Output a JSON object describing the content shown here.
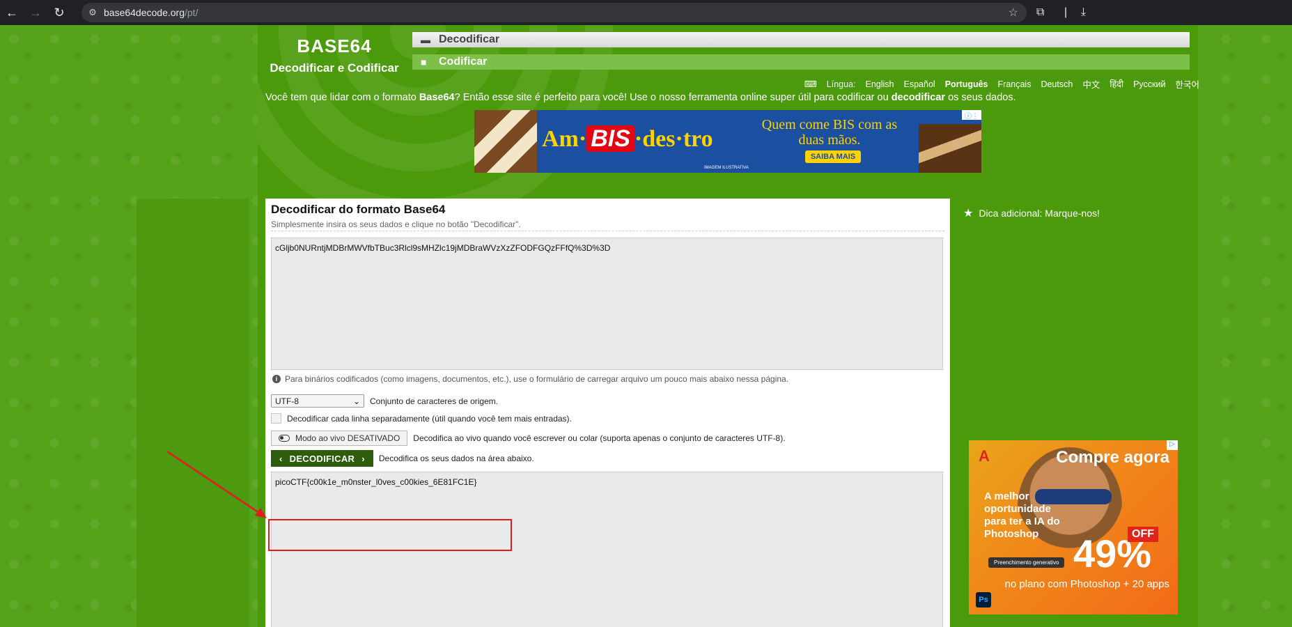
{
  "browser": {
    "url_host": "base64decode.org",
    "url_path": "/pt/",
    "nav": {
      "back": "←",
      "forward": "→",
      "reload": "↻"
    }
  },
  "logo": {
    "line1": "BASE64",
    "line2": "Decodificar e Codificar"
  },
  "menu": {
    "decode": "Decodificar",
    "encode": "Codificar"
  },
  "languages": {
    "label": "Língua:",
    "items": [
      "English",
      "Español",
      "Português",
      "Français",
      "Deutsch",
      "中文",
      "हिंदी",
      "Русский",
      "한국어"
    ],
    "active": "Português"
  },
  "intro": {
    "p1": "Você tem que lidar com o formato ",
    "b1": "Base64",
    "p2": "? Então esse site é perfeito para você! Use o nosso ferramenta online super útil para codificar ou ",
    "b2": "decodificar",
    "p3": " os seus dados."
  },
  "ad_top": {
    "brand_a": "Am·",
    "brand_bis": "BIS",
    "brand_b": "·des·tro",
    "slogan": "Quem come BIS com as duas mãos.",
    "cta": "SAIBA MAIS",
    "note": "IMAGEM ILUSTRATIVA"
  },
  "form": {
    "title": "Decodificar do formato Base64",
    "subtitle": "Simplesmente insira os seus dados e clique no botão \"Decodificar\".",
    "input_value": "cGljb0NURntjMDBrMWVfbTBuc3Rlcl9sMHZlc19jMDBraWVzXzZFODFGQzFFfQ%3D%3D",
    "info": "Para binários codificados (como imagens, documentos, etc.), use o formulário de carregar arquivo um pouco mais abaixo nessa página.",
    "charset_value": "UTF-8",
    "charset_label": "Conjunto de caracteres de origem.",
    "each_line_label": "Decodificar cada linha separadamente (útil quando você tem mais entradas).",
    "live_button": "Modo ao vivo DESATIVADO",
    "live_label": "Decodifica ao vivo quando você escrever ou colar (suporta apenas o conjunto de caracteres UTF-8).",
    "decode_button": "DECODIFICAR",
    "decode_label": "Decodifica os seus dados na área abaixo.",
    "output_value": "picoCTF{c00k1e_m0nster_l0ves_c00kies_6E81FC1E}"
  },
  "tip": "Dica adicional: Marque-nos!",
  "ad_side": {
    "headline": "Compre agora",
    "text": "A melhor oportunidade para ter a IA do Photoshop",
    "chip": "Preenchimento generativo",
    "percent": "49%",
    "off": "OFF",
    "footer": "no plano com Photoshop + 20 apps",
    "ps": "Ps"
  },
  "colors": {
    "page_green": "#4a9a0b",
    "highlight_red": "#e31b1b",
    "button_dark_green": "#2c5c0c"
  }
}
